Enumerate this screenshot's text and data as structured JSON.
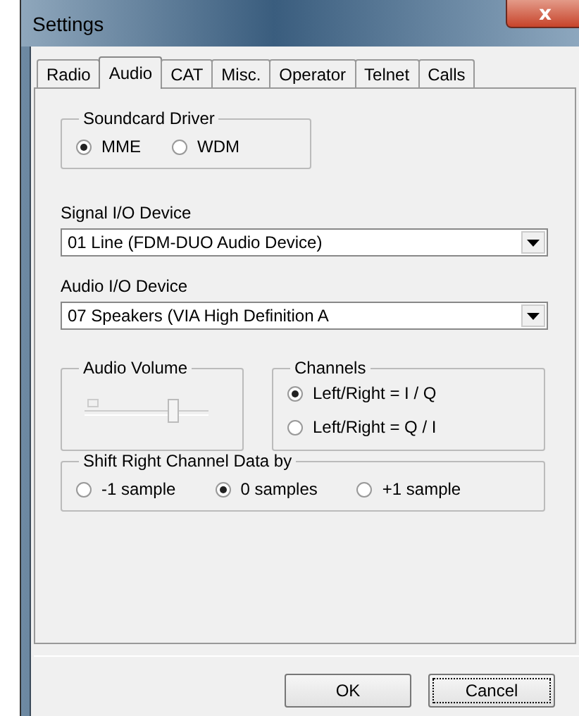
{
  "window": {
    "title": "Settings",
    "close": "x"
  },
  "tabs": [
    {
      "label": "Radio",
      "selected": false
    },
    {
      "label": "Audio",
      "selected": true
    },
    {
      "label": "CAT",
      "selected": false
    },
    {
      "label": "Misc.",
      "selected": false
    },
    {
      "label": "Operator",
      "selected": false
    },
    {
      "label": "Telnet",
      "selected": false
    },
    {
      "label": "Calls",
      "selected": false
    }
  ],
  "soundcard_driver": {
    "title": "Soundcard Driver",
    "options": [
      {
        "label": "MME",
        "selected": true
      },
      {
        "label": "WDM",
        "selected": false
      }
    ]
  },
  "signal_device": {
    "label": "Signal I/O Device",
    "value": "01  Line (FDM-DUO Audio Device)"
  },
  "audio_device": {
    "label": "Audio I/O Device",
    "value": "07  Speakers (VIA High Definition A"
  },
  "audio_volume": {
    "title": "Audio Volume",
    "level": 0.72,
    "disabled": true
  },
  "channels": {
    "title": "Channels",
    "options": [
      {
        "label": "Left/Right = I / Q",
        "selected": true
      },
      {
        "label": "Left/Right = Q / I",
        "selected": false
      }
    ]
  },
  "shift": {
    "title": "Shift Right Channel Data by",
    "options": [
      {
        "label": "-1 sample",
        "selected": false
      },
      {
        "label": "0 samples",
        "selected": true
      },
      {
        "label": "+1 sample",
        "selected": false
      }
    ]
  },
  "buttons": [
    {
      "label": "OK",
      "focused": false
    },
    {
      "label": "Cancel",
      "focused": true
    }
  ]
}
